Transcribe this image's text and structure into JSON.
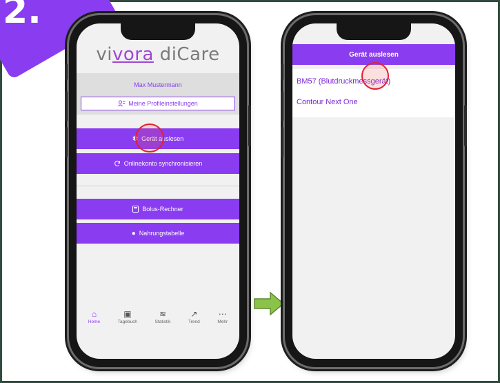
{
  "step_badge": {
    "number": "2."
  },
  "left_phone": {
    "logo": {
      "part1": "vi",
      "accent": "vora",
      "part2": " diCare"
    },
    "user_name": "Max Mustermann",
    "profile_settings_label": "Meine Profileinstellungen",
    "menu": {
      "read_device": "Gerät auslesen",
      "sync_account": "Onlinekonto synchronisieren",
      "bolus_calculator": "Bolus-Rechner",
      "nutrition_table": "Nahrungstabelle"
    },
    "nav": [
      {
        "label": "Home",
        "icon": "home-icon",
        "active": true
      },
      {
        "label": "Tagebuch",
        "icon": "diary-icon",
        "active": false
      },
      {
        "label": "Statistik",
        "icon": "statistics-icon",
        "active": false
      },
      {
        "label": "Trend",
        "icon": "trend-icon",
        "active": false
      },
      {
        "label": "Mehr",
        "icon": "more-icon",
        "active": false
      }
    ]
  },
  "right_phone": {
    "header_title": "Gerät auslesen",
    "devices": [
      "BM57 (Blutdruckmessgerät)",
      "Contour Next One"
    ]
  },
  "colors": {
    "accent_purple": "#8a3cf0",
    "highlight_red": "#e02030",
    "arrow_green": "#8bc34a",
    "frame": "#2f4c3f"
  }
}
